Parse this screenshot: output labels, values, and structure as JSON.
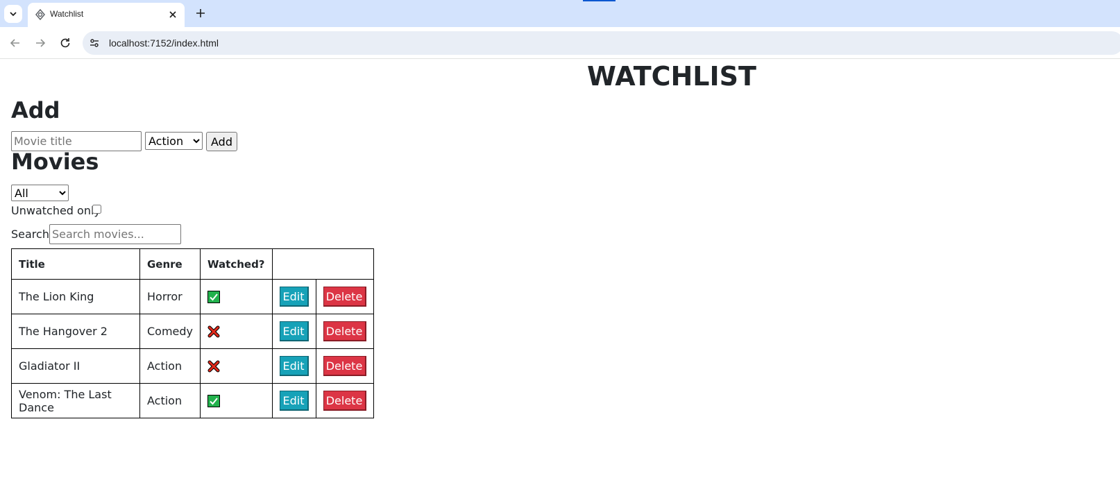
{
  "browser": {
    "tab_title": "Watchlist",
    "url": "localhost:7152/index.html"
  },
  "page": {
    "title": "WATCHLIST",
    "add_section": {
      "heading": "Add",
      "title_placeholder": "Movie title",
      "title_value": "",
      "genre_selected": "Action",
      "add_button": "Add"
    },
    "movies_section": {
      "heading": "Movies",
      "filter_selected": "All",
      "unwatched_label": "Unwatched only",
      "unwatched_checked": false,
      "search_label": "Search:",
      "search_placeholder": "Search movies..."
    },
    "table": {
      "headers": [
        "Title",
        "Genre",
        "Watched?",
        ""
      ],
      "rows": [
        {
          "title": "The Lion King",
          "genre": "Horror",
          "watched": true,
          "watched_icon": "check-icon",
          "edit": "Edit",
          "delete": "Delete"
        },
        {
          "title": "The Hangover 2",
          "genre": "Comedy",
          "watched": false,
          "watched_icon": "cross-icon",
          "edit": "Edit",
          "delete": "Delete"
        },
        {
          "title": "Gladiator II",
          "genre": "Action",
          "watched": false,
          "watched_icon": "cross-icon",
          "edit": "Edit",
          "delete": "Delete"
        },
        {
          "title": "Venom: The Last Dance",
          "genre": "Action",
          "watched": true,
          "watched_icon": "check-icon",
          "edit": "Edit",
          "delete": "Delete"
        }
      ]
    }
  },
  "colors": {
    "edit_button": "#17a2b8",
    "delete_button": "#dc3545",
    "watched_yes": "#22b14c",
    "watched_no": "#e0291b"
  }
}
